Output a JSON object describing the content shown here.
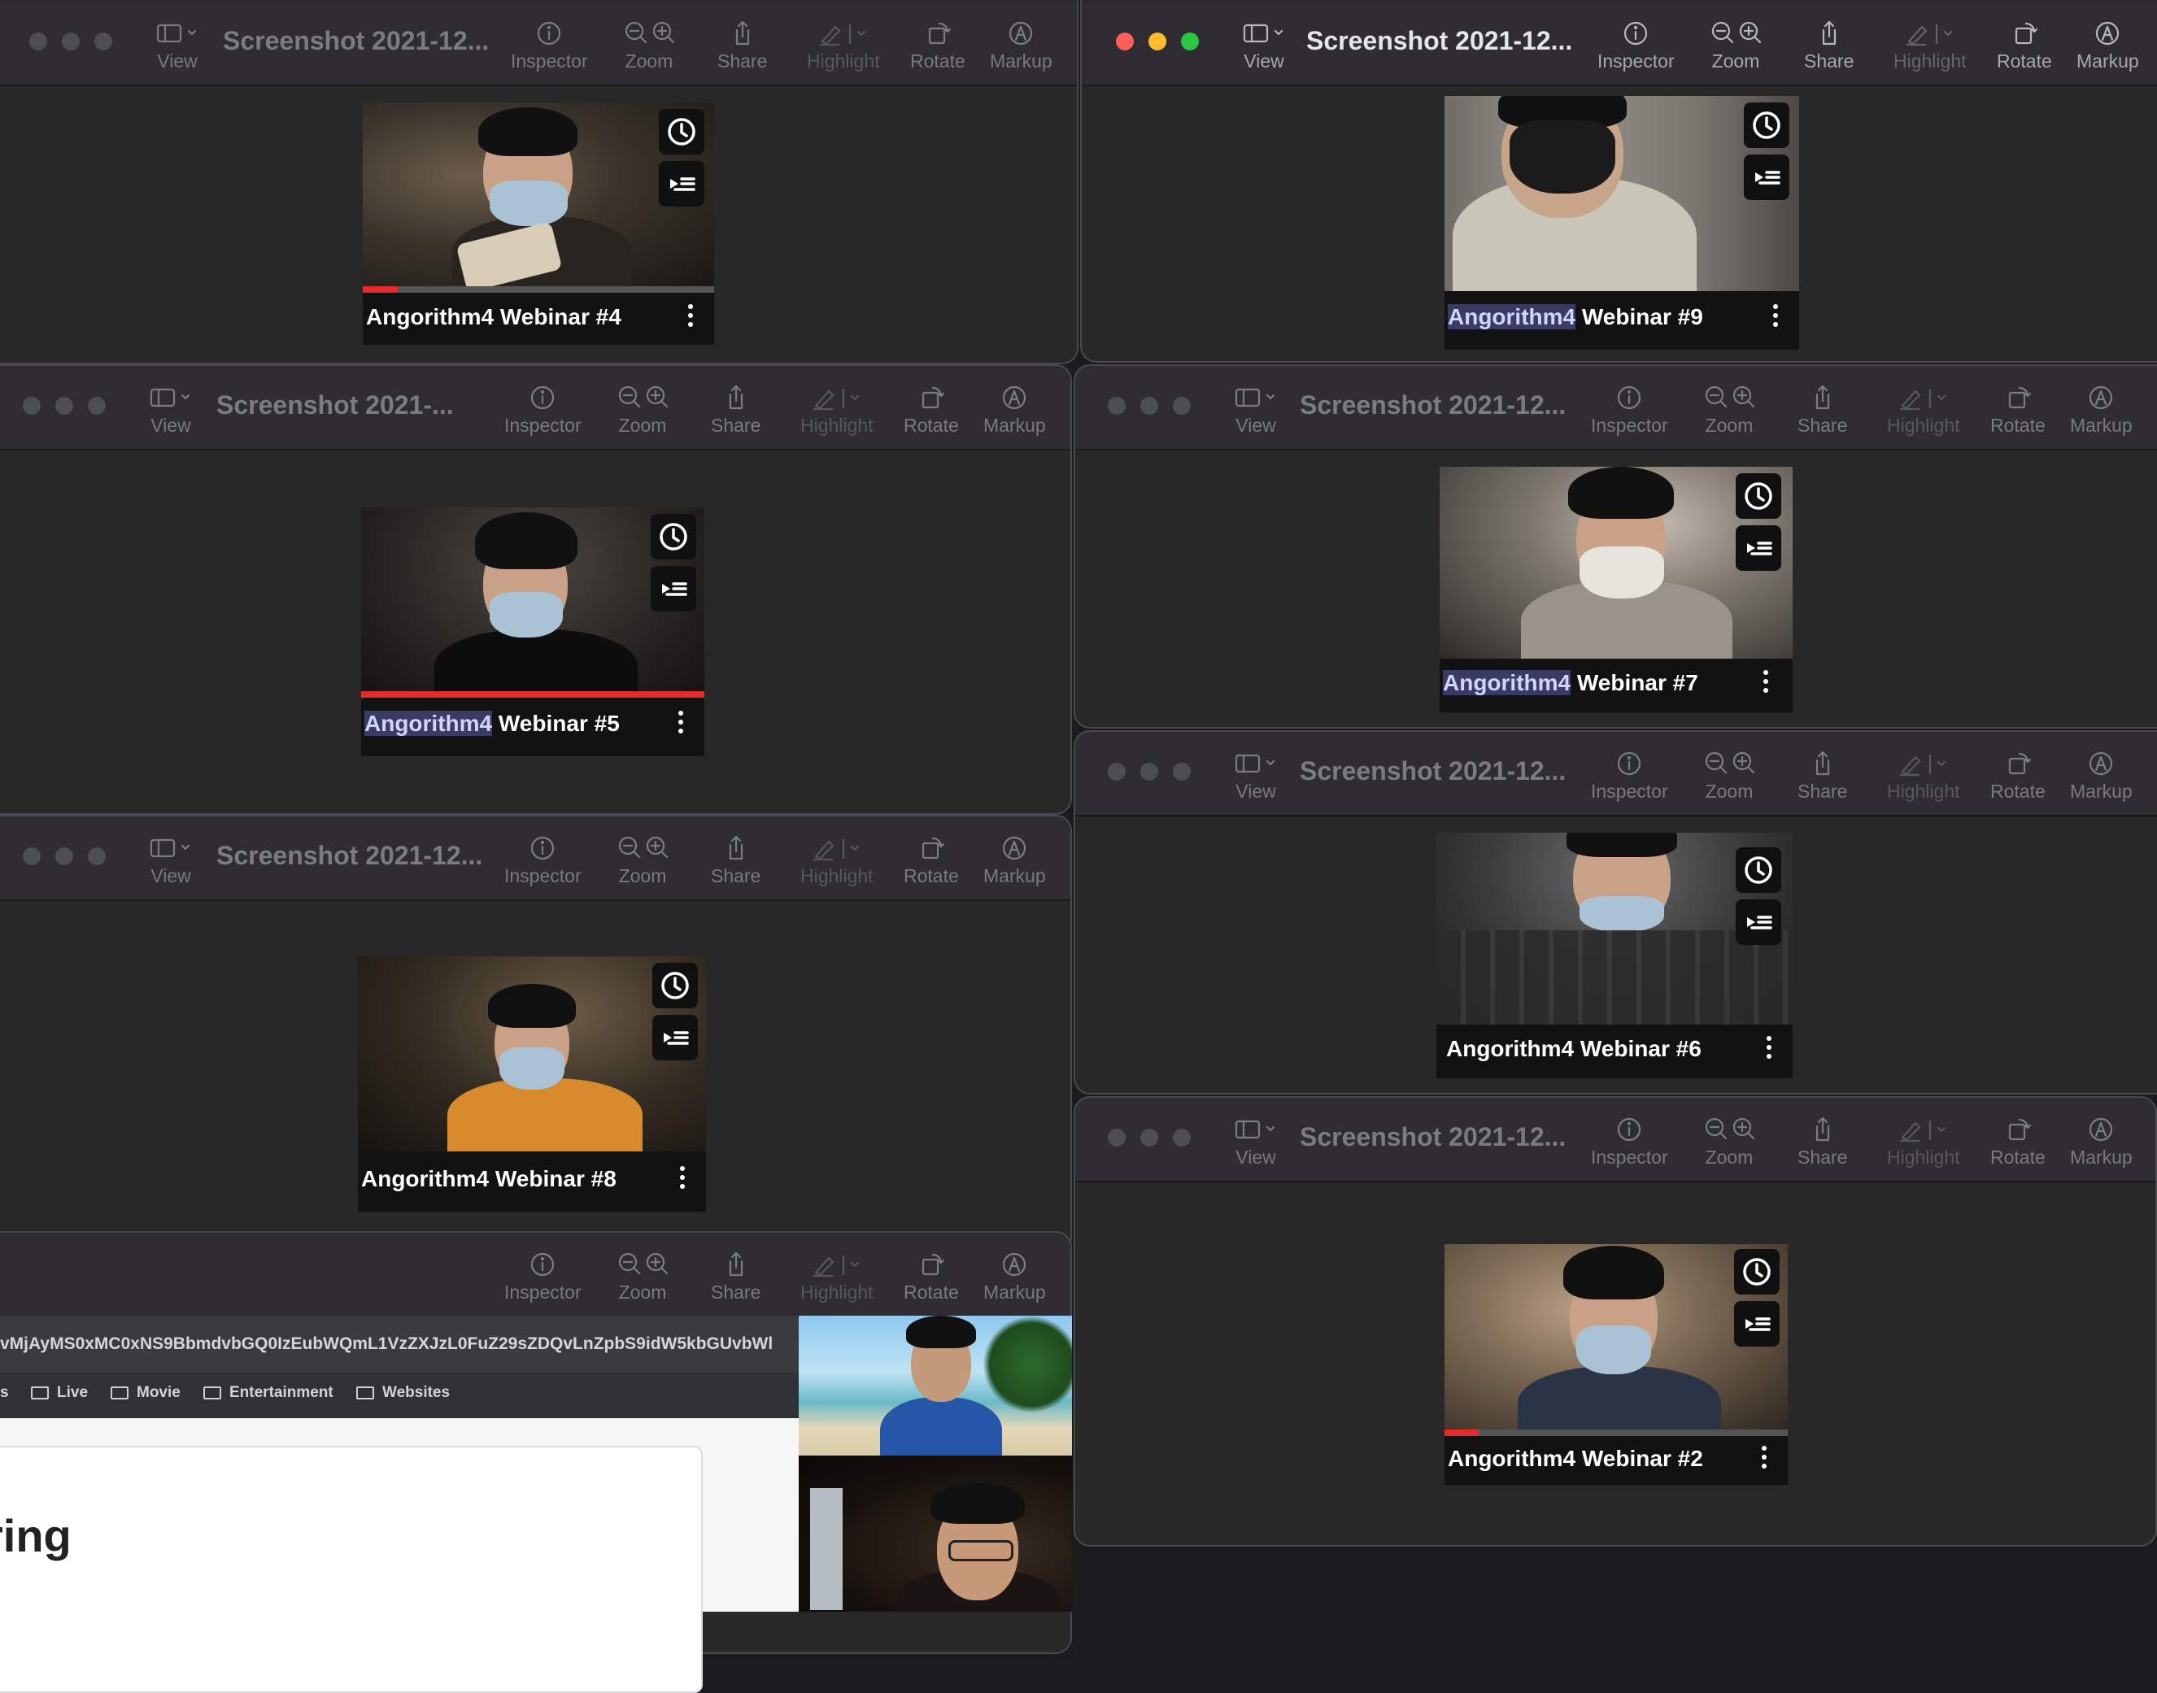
{
  "toolbar": {
    "view": "View",
    "inspector": "Inspector",
    "zoom": "Zoom",
    "share": "Share",
    "highlight": "Highlight",
    "rotate": "Rotate",
    "markup": "Markup"
  },
  "windows": {
    "w4": {
      "title": "Screenshot 2021-12...",
      "caption_app": "Angorithm4",
      "caption_rest": " Webinar #4"
    },
    "w9": {
      "title": "Screenshot 2021-12...",
      "caption_app": "Angorithm4",
      "caption_rest": " Webinar #9"
    },
    "w5": {
      "title": "Screenshot 2021-...",
      "caption_app": "Angorithm4",
      "caption_rest": " Webinar #5"
    },
    "w7": {
      "title": "Screenshot 2021-12...",
      "caption_app": "Angorithm4",
      "caption_rest": " Webinar #7"
    },
    "w8": {
      "title": "Screenshot 2021-12...",
      "caption_app": "Angorithm4",
      "caption_rest": " Webinar #8"
    },
    "w6": {
      "title": "Screenshot 2021-12...",
      "caption_app": "Angorithm4",
      "caption_rest": " Webinar #6"
    },
    "w2": {
      "title": "Screenshot 2021-12...",
      "caption_app": "Angorithm4",
      "caption_rest": " Webinar #2"
    }
  },
  "progress": {
    "w4": 0.1,
    "w5": 1.0,
    "w2": 0.1
  },
  "browser": {
    "url": "vMjAyMS0xMC0xNS9BbmdvbGQ0IzEubWQmL1VzZXJzL0FuZ29sZDQvLnZpbS9idW5kbGUvbWl",
    "bookmarks": [
      "s",
      "Live",
      "Movie",
      "Entertainment",
      "Websites"
    ],
    "page_title": "ring"
  },
  "colors": {
    "accent_progress": "#e52b2b",
    "traffic_red": "#ff5f57",
    "traffic_yellow": "#febc2e",
    "traffic_green": "#28c840"
  }
}
